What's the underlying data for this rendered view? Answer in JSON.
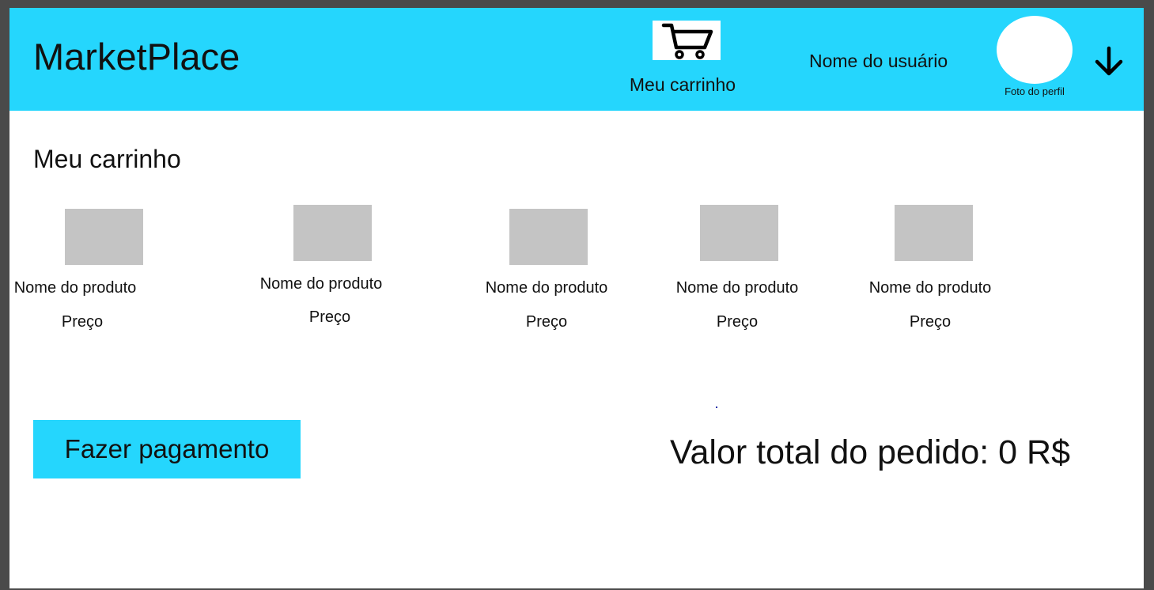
{
  "header": {
    "brand": "MarketPlace",
    "cart_label": "Meu carrinho",
    "username": "Nome do usuário",
    "avatar_caption": "Foto do perfil",
    "cart_icon": "shopping-cart-icon",
    "menu_icon": "arrow-down-icon"
  },
  "main": {
    "title": "Meu carrinho",
    "products": [
      {
        "name": "Nome do produto",
        "price": "Preço"
      },
      {
        "name": "Nome do produto",
        "price": "Preço"
      },
      {
        "name": "Nome do produto",
        "price": "Preço"
      },
      {
        "name": "Nome do produto",
        "price": "Preço"
      },
      {
        "name": "Nome do produto",
        "price": "Preço"
      }
    ],
    "pay_button": "Fazer pagamento",
    "total_label": "Valor total do pedido: 0 R$"
  },
  "colors": {
    "accent": "#25d6fd",
    "placeholder": "#c4c4c4",
    "text": "#111111",
    "background": "#ffffff"
  }
}
